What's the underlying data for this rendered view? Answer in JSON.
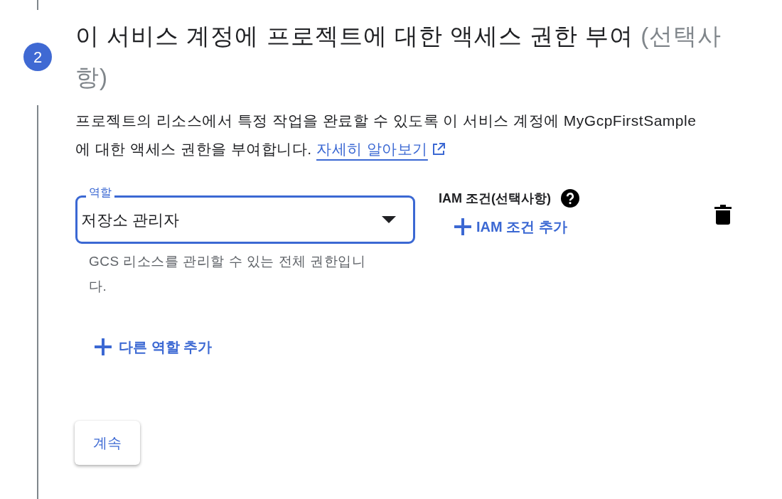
{
  "step": {
    "number": "2",
    "title": "이 서비스 계정에 프로젝트에 대한 액세스 권한 부여",
    "optional_label": "(선택사항)"
  },
  "description": {
    "text": "프로젝트의 리소스에서 특정 작업을 완료할 수 있도록 이 서비스 계정에 MyGcpFirstSample에 대한 액세스 권한을 부여합니다.",
    "link": "자세히 알아보기"
  },
  "role_field": {
    "label": "역할",
    "value": "저장소 관리자",
    "focused": true,
    "helper": "GCS 리소스를 관리할 수 있는 전체 권한입니다."
  },
  "iam_condition": {
    "label": "IAM 조건(선택사항)",
    "add_button": "IAM 조건 추가"
  },
  "add_role_button": "다른 역할 추가",
  "continue_button": "계속"
}
